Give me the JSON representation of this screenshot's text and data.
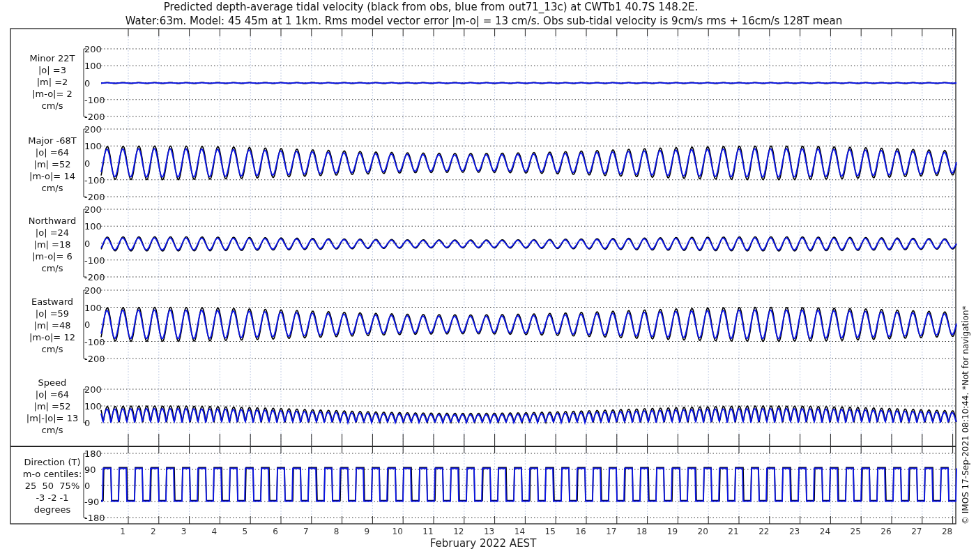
{
  "title": {
    "lines": [
      "Predicted depth-average tidal velocity (black from obs, blue from out71_13c) at CWTb1 40.7S 148.2E.",
      "Water:63m. Model: 45 45m at 1 1km. Rms model vector error |m-o| = 13 cm/s. Obs sub-tidal velocity is 9cm/s rms + 16cm/s 128T mean"
    ]
  },
  "panels": [
    {
      "kind": "flat",
      "label": [
        "Minor 22T",
        "|o| =3",
        "|m| =2",
        "|m-o|= 2",
        "cm/s"
      ],
      "yticks": [
        "200",
        "100",
        "0",
        "-100",
        "-200"
      ]
    },
    {
      "kind": "wave",
      "label": [
        "Major -68T",
        "|o| =64",
        "|m| =52",
        "|m-o|= 14",
        "cm/s"
      ],
      "yticks": [
        "200",
        "100",
        "0",
        "-100",
        "-200"
      ]
    },
    {
      "kind": "ripple",
      "label": [
        "Northward",
        "|o| =24",
        "|m| =18",
        "|m-o|= 6",
        "cm/s"
      ],
      "yticks": [
        "200",
        "100",
        "0",
        "-100",
        "-200"
      ]
    },
    {
      "kind": "wave",
      "label": [
        "Eastward",
        "|o| =59",
        "|m| =48",
        "|m-o|= 12",
        "cm/s"
      ],
      "yticks": [
        "200",
        "100",
        "0",
        "-100",
        "-200"
      ]
    },
    {
      "kind": "rectified",
      "label": [
        "Speed",
        "|o| =64",
        "|m| =52",
        "|m|-|o|= 13",
        "cm/s"
      ],
      "yticks": [
        "200",
        "100",
        "0"
      ]
    },
    {
      "kind": "square",
      "label": [
        "Direction (T)",
        "m-o centiles:",
        "25  50  75%",
        "-3 -2 -1",
        "degrees"
      ],
      "yticks": [
        "180",
        "90",
        "0",
        "-90",
        "-180"
      ]
    }
  ],
  "x_axis": {
    "ticks": [
      "1",
      "2",
      "3",
      "4",
      "5",
      "6",
      "7",
      "8",
      "9",
      "10",
      "11",
      "12",
      "13",
      "14",
      "15",
      "16",
      "17",
      "18",
      "19",
      "20",
      "21",
      "22",
      "23",
      "24",
      "25",
      "26",
      "27",
      "28"
    ],
    "label": "February 2022 AEST"
  },
  "side_note": "© IMOS 17-Sep-2021 08:10:44. *Not for navigation*"
}
